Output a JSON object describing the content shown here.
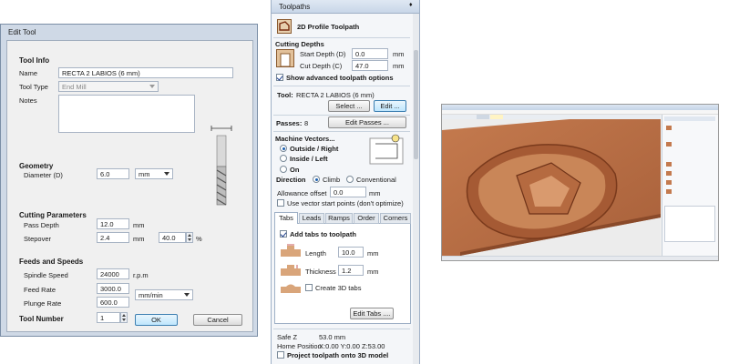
{
  "edit_tool": {
    "title": "Edit Tool",
    "tool_info_header": "Tool Info",
    "name_label": "Name",
    "name_value": "RECTA 2 LABIOS (6 mm)",
    "tool_type_label": "Tool Type",
    "tool_type_value": "End Mill",
    "notes_label": "Notes",
    "geometry_header": "Geometry",
    "diameter_label": "Diameter (D)",
    "diameter_value": "6.0",
    "diameter_unit": "mm",
    "cutting_header": "Cutting Parameters",
    "pass_depth_label": "Pass Depth",
    "pass_depth_value": "12.0",
    "pass_depth_unit": "mm",
    "stepover_label": "Stepover",
    "stepover_value": "2.4",
    "stepover_unit": "mm",
    "stepover_pct_value": "40.0",
    "stepover_pct_unit": "%",
    "feeds_header": "Feeds and Speeds",
    "spindle_label": "Spindle Speed",
    "spindle_value": "24000",
    "spindle_unit": "r.p.m",
    "feed_label": "Feed Rate",
    "feed_value": "3000.0",
    "feed_unit": "mm/min",
    "plunge_label": "Plunge Rate",
    "plunge_value": "600.0",
    "tool_number_label": "Tool Number",
    "tool_number_value": "1",
    "ok_label": "OK",
    "cancel_label": "Cancel"
  },
  "toolpaths": {
    "panel_title": "Toolpaths",
    "pin": "♦",
    "profile_title": "2D Profile Toolpath",
    "cutting_depths_header": "Cutting Depths",
    "start_depth_label": "Start Depth (D)",
    "start_depth_value": "0.0",
    "start_depth_unit": "mm",
    "cut_depth_label": "Cut Depth (C)",
    "cut_depth_value": "47.0",
    "cut_depth_unit": "mm",
    "advanced_label": "Show advanced toolpath options",
    "tool_label": "Tool:",
    "tool_value": "RECTA 2 LABIOS (6 mm)",
    "select_label": "Select ...",
    "edit_label": "Edit ...",
    "passes_label": "Passes:",
    "passes_value": "8",
    "edit_passes_label": "Edit Passes ...",
    "machine_vectors_header": "Machine Vectors...",
    "outside_label": "Outside / Right",
    "inside_label": "Inside / Left",
    "on_label": "On",
    "direction_label": "Direction",
    "climb_label": "Climb",
    "conventional_label": "Conventional",
    "allowance_label": "Allowance offset",
    "allowance_value": "0.0",
    "allowance_unit": "mm",
    "vector_start_label": "Use vector start points (don't optimize)",
    "tabs": [
      "Tabs",
      "Leads",
      "Ramps",
      "Order",
      "Corners"
    ],
    "add_tabs_label": "Add tabs to toolpath",
    "length_label": "Length",
    "length_value": "10.0",
    "length_unit": "mm",
    "thickness_label": "Thickness",
    "thickness_value": "1.2",
    "thickness_unit": "mm",
    "create3d_label": "Create 3D tabs",
    "edit_tabs_label": "Edit Tabs ....",
    "safe_z_label": "Safe Z",
    "safe_z_value": "53.0 mm",
    "home_label": "Home Position",
    "home_value": "X:0.00 Y:0.00 Z:53.00",
    "project_label": "Project toolpath onto 3D model"
  },
  "colors": {
    "wood": "#b5693f",
    "dialog_bg": "#f0f0f0",
    "panel_bg": "#f4f6f9",
    "accent": "#1b5fb0"
  }
}
